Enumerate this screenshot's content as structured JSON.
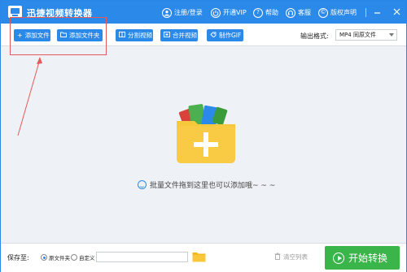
{
  "titlebar": {
    "app_title": "迅捷视频转换器",
    "links": [
      {
        "label": "注册/登录",
        "icon": "user-icon"
      },
      {
        "label": "开通VIP",
        "icon": "power-icon"
      },
      {
        "label": "帮助",
        "icon": "help-icon"
      },
      {
        "label": "客服",
        "icon": "headset-icon"
      },
      {
        "label": "版权声明",
        "icon": "copyright-icon"
      }
    ]
  },
  "toolbar": {
    "buttons": [
      {
        "label": "添加文件",
        "icon": "plus-icon"
      },
      {
        "label": "添加文件夹",
        "icon": "folder-icon"
      },
      {
        "label": "分割视频",
        "icon": "split-icon"
      },
      {
        "label": "合并视频",
        "icon": "merge-icon"
      },
      {
        "label": "制作GIF",
        "icon": "gif-icon"
      }
    ],
    "output_format_label": "输出格式:",
    "output_format_value": "MP4  同原文件"
  },
  "main": {
    "drop_hint": "批量文件拖到这里也可以添加哦~ ~ ~"
  },
  "bottom": {
    "save_label": "保存至:",
    "radio_original": "原文件夹",
    "radio_custom": "自定义",
    "path_value": "",
    "clear_label": "清空列表",
    "start_label": "开始转换"
  },
  "colors": {
    "brand_blue": "#2b89ea",
    "start_green": "#39b54a",
    "annotation_red": "#e45a5a",
    "folder_yellow": "#f8c83c"
  }
}
